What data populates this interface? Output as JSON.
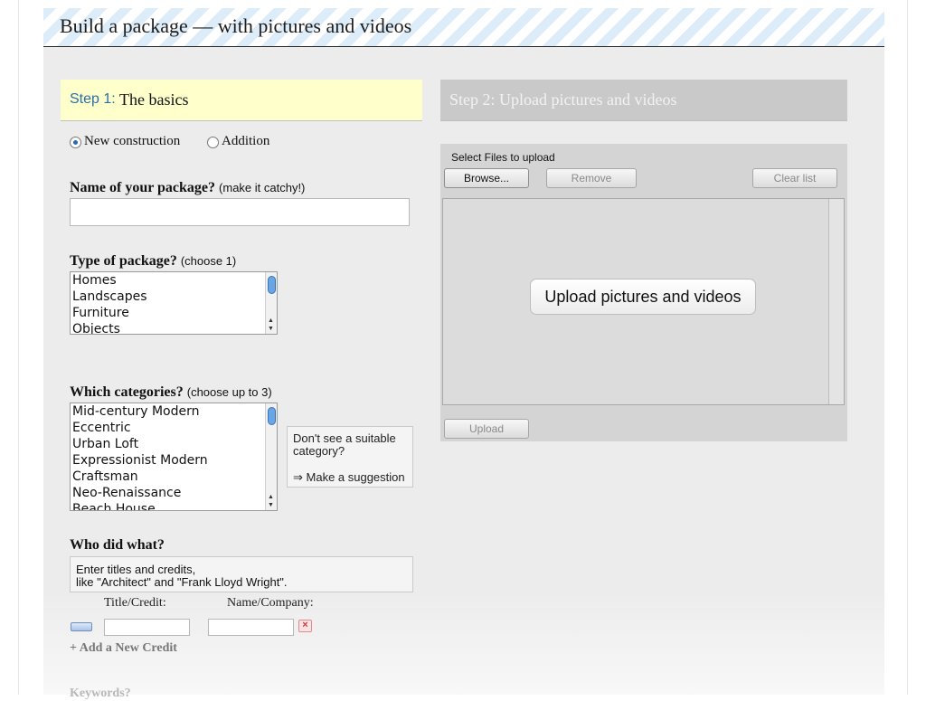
{
  "banner": {
    "title": "Build a package — with pictures and videos"
  },
  "step1": {
    "number_label": "Step 1:",
    "title": "The basics",
    "construction": {
      "options": [
        {
          "label": "New construction",
          "checked": true
        },
        {
          "label": "Addition",
          "checked": false
        }
      ]
    },
    "name": {
      "label": "Name of your package?",
      "hint": "(make it catchy!)",
      "value": ""
    },
    "type": {
      "label": "Type of package?",
      "hint": "(choose 1)",
      "options": [
        "Homes",
        "Landscapes",
        "Furniture",
        "Objects"
      ]
    },
    "categories": {
      "label": "Which categories?",
      "hint": "(choose up to 3)",
      "options": [
        "Mid-century Modern",
        "Eccentric",
        "Urban Loft",
        "Expressionist Modern",
        "Craftsman",
        "Neo-Renaissance",
        "Beach House"
      ]
    },
    "suggestion": {
      "text": "Don't see a suitable category?",
      "link": "⇒ Make a suggestion"
    },
    "credits": {
      "label": "Who did what?",
      "info_line1": "Enter titles and credits,",
      "info_line2": "like \"Architect\" and \"Frank Lloyd Wright\".",
      "col_title": "Title/Credit:",
      "col_name": "Name/Company:",
      "title_value": "",
      "name_value": "",
      "add_label": "+ Add a New Credit"
    },
    "keywords": {
      "label": "Keywords?"
    }
  },
  "step2": {
    "title": "Step 2: Upload pictures and videos",
    "select_label": "Select Files to upload",
    "browse": "Browse...",
    "remove": "Remove",
    "clear": "Clear list",
    "big_button": "Upload pictures and videos",
    "upload": "Upload"
  },
  "colors": {
    "step_accent": "#2a6fa8",
    "step1_bg": "#ffffcc",
    "step2_bg": "#c9c9c9",
    "banner_stripe": "#dcecf8"
  }
}
